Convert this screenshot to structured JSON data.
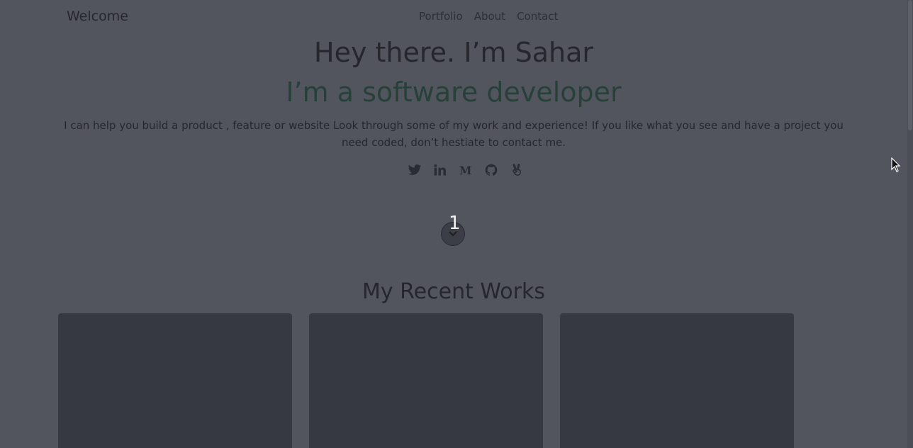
{
  "header": {
    "brand": "Welcome",
    "nav": [
      {
        "label": "Portfolio"
      },
      {
        "label": "About"
      },
      {
        "label": "Contact"
      }
    ]
  },
  "hero": {
    "title": "Hey there. I’m Sahar",
    "subtitle": "I’m a software developer",
    "description": "I can help you build a product , feature or website Look through some of my work and experience! If you like what you see and have a project you need coded, don’t hestiate to contact me.",
    "socials": [
      {
        "icon": "twitter-icon"
      },
      {
        "icon": "linkedin-icon"
      },
      {
        "icon": "medium-icon"
      },
      {
        "icon": "github-icon"
      },
      {
        "icon": "angellist-icon"
      }
    ]
  },
  "scroll_indicator": {
    "number": "1",
    "icon": "chevron-down-icon"
  },
  "works": {
    "title": "My Recent Works",
    "cards": [
      {},
      {},
      {}
    ]
  },
  "colors": {
    "background": "#52555e",
    "title_text": "#25272d",
    "subtitle_text": "#274139",
    "card": "#363942"
  }
}
